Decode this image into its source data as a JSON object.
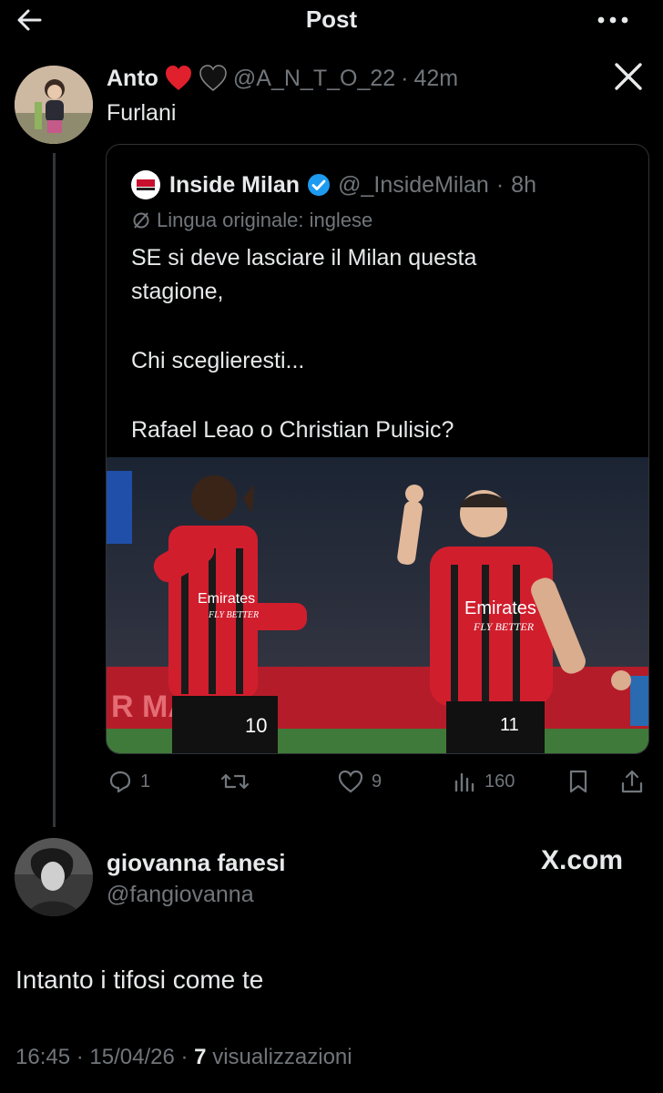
{
  "header": {
    "title": "Post"
  },
  "post": {
    "author_name": "Anto",
    "author_handle": "@A_N_T_O_22",
    "sep": "·",
    "time": "42m",
    "text": "Furlani",
    "source_mark": "X"
  },
  "quote": {
    "author_name": "Inside Milan",
    "author_handle": "@_InsideMilan",
    "sep": "·",
    "time": "8h",
    "translation_note": "Lingua originale: inglese",
    "line1": "SE si deve lasciare il Milan questa",
    "line2": "stagione,",
    "line3": "Chi sceglieresti...",
    "line4": "Rafael Leao o Christian Pulisic?",
    "player1_number": "10",
    "player2_number": "11",
    "sponsor_top": "Emirates",
    "sponsor_bottom": "FLY BETTER"
  },
  "actions": {
    "replies": "1",
    "likes": "9",
    "views": "160"
  },
  "reply": {
    "author_name": "giovanna fanesi",
    "author_handle": "@fangiovanna",
    "site": "X.com",
    "text": "Intanto i tifosi come te"
  },
  "footer": {
    "time": "16:45",
    "sep1": "·",
    "date": "15/04/26",
    "sep2": "·",
    "views_count": "7",
    "views_label": "visualizzazioni"
  },
  "colors": {
    "background": "#000000",
    "text": "#e7e9ea",
    "muted": "#71767b",
    "verified": "#1d9bf0",
    "milan_red": "#c8102e"
  },
  "icons": {
    "back": "arrow-left-icon",
    "more": "more-horizontal-icon",
    "heart_red": "red-heart-emoji",
    "heart_black": "black-heart-emoji",
    "x_logo": "x-logo-icon",
    "verified": "verified-badge-icon",
    "translate": "no-entry-translate-icon",
    "reply": "reply-icon",
    "repost": "repost-icon",
    "like": "heart-icon",
    "views": "views-bar-icon",
    "bookmark": "bookmark-icon",
    "share": "share-icon"
  }
}
